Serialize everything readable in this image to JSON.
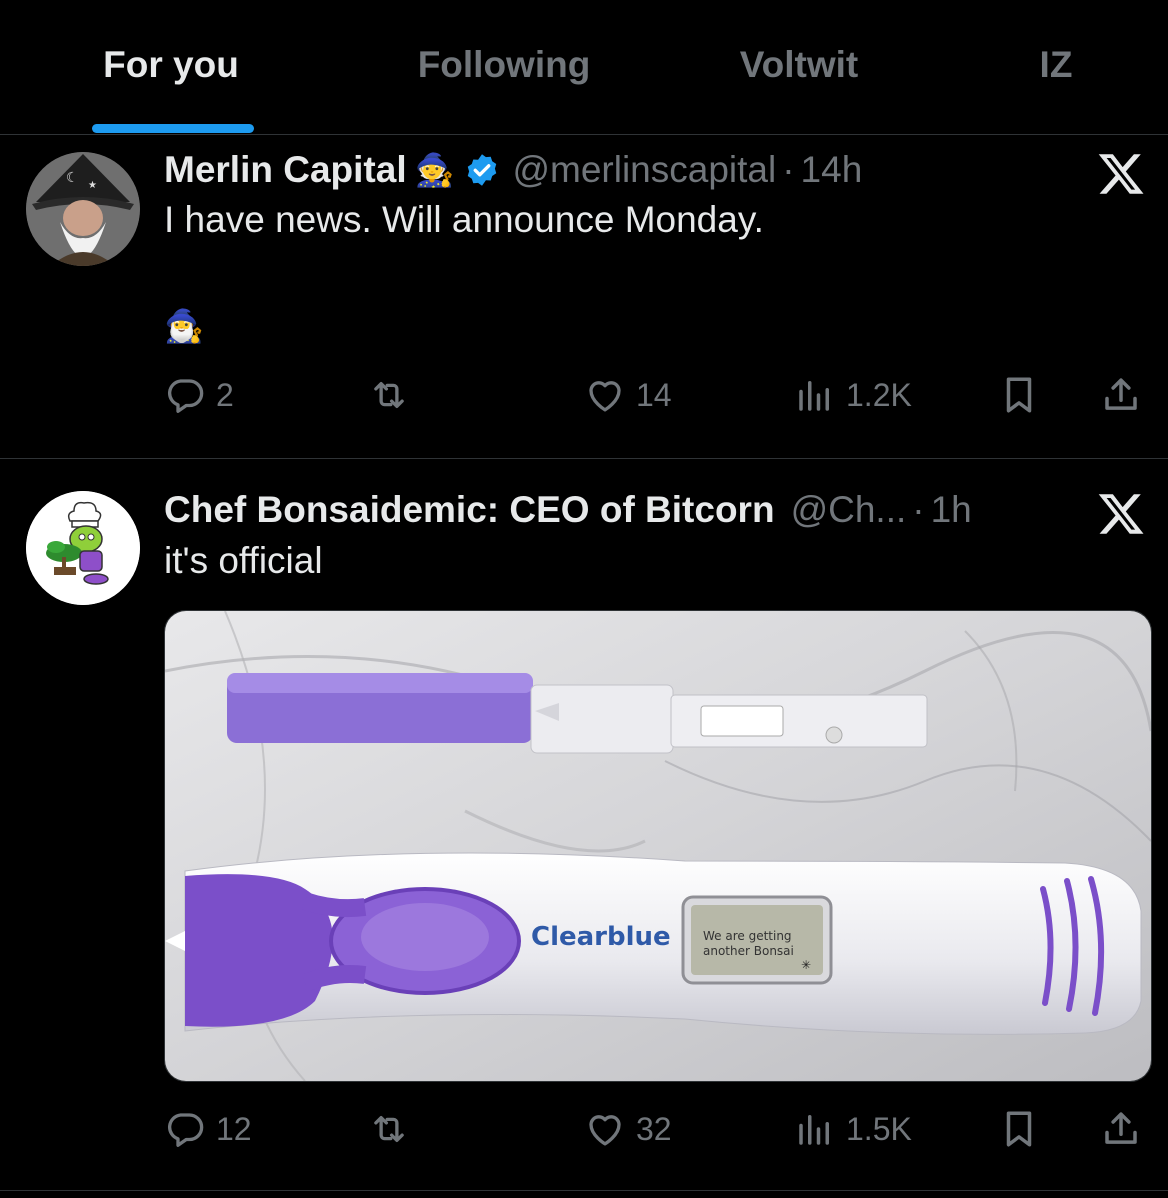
{
  "tabs": [
    {
      "label": "For you",
      "active": true
    },
    {
      "label": "Following",
      "active": false
    },
    {
      "label": "Voltwit",
      "active": false
    },
    {
      "label": "IZ",
      "active": false
    }
  ],
  "posts": [
    {
      "name": "Merlin Capital",
      "name_emoji": "🧙",
      "verified": true,
      "handle": "@merlinscapital",
      "dot": "·",
      "time": "14h",
      "text": "I have news. Will announce Monday.",
      "text2": "🧙‍♂️",
      "replies": "2",
      "reposts": "",
      "likes": "14",
      "views": "1.2K"
    },
    {
      "name": "Chef Bonsaidemic: CEO of Bitcorn",
      "handle": "@Ch...",
      "dot": "·",
      "time": "1h",
      "text": "it's official",
      "image": {
        "brand": "Clearblue",
        "screen_line1": "We are getting",
        "screen_line2": "another Bonsai"
      },
      "replies": "12",
      "reposts": "",
      "likes": "32",
      "views": "1.5K"
    }
  ],
  "colors": {
    "accent": "#1d9bf0",
    "muted": "#71767b",
    "text": "#e7e9ea",
    "background": "#000000",
    "purple": "#7b4fc9"
  }
}
